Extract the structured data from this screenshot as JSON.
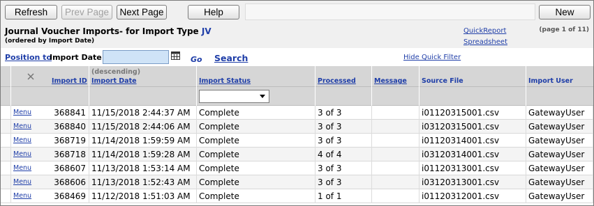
{
  "toolbar": {
    "refresh_label": "Refresh",
    "prev_page_label": "Prev Page",
    "next_page_label": "Next Page",
    "help_label": "Help",
    "new_label": "New"
  },
  "title": {
    "main_prefix": "Journal Voucher Imports- for Import Type ",
    "import_type": "JV",
    "subtitle": "(ordered by Import Date)",
    "quick_report": "QuickReport",
    "spreadsheet": "Spreadsheet",
    "page_info": "(page 1 of 11)"
  },
  "position": {
    "link_label": "Position to",
    "field_label": "Import Date",
    "input_value": "",
    "go_label": "Go",
    "search_label": "Search",
    "hide_filter_label": "Hide Quick Filter"
  },
  "grid": {
    "columns": {
      "import_id": "Import ID",
      "import_date_sort": "(descending)",
      "import_date": "Import Date",
      "import_status": "Import Status",
      "processed": "Processed",
      "message": "Message",
      "source_file": "Source File",
      "import_user": "Import User"
    },
    "filter": {
      "status_selected": ""
    },
    "rows": [
      {
        "menu": "Menu",
        "id": "368841",
        "date": "11/15/2018 2:44:37 AM",
        "status": "Complete",
        "processed": "3 of 3",
        "message": "",
        "file": "i01120315001.csv",
        "user": "GatewayUser"
      },
      {
        "menu": "Menu",
        "id": "368840",
        "date": "11/15/2018 2:44:06 AM",
        "status": "Complete",
        "processed": "3 of 3",
        "message": "",
        "file": "i03120315001.csv",
        "user": "GatewayUser"
      },
      {
        "menu": "Menu",
        "id": "368719",
        "date": "11/14/2018 1:59:59 AM",
        "status": "Complete",
        "processed": "3 of 3",
        "message": "",
        "file": "i01120314001.csv",
        "user": "GatewayUser"
      },
      {
        "menu": "Menu",
        "id": "368718",
        "date": "11/14/2018 1:59:28 AM",
        "status": "Complete",
        "processed": "4 of 4",
        "message": "",
        "file": "i03120314001.csv",
        "user": "GatewayUser"
      },
      {
        "menu": "Menu",
        "id": "368607",
        "date": "11/13/2018 1:53:14 AM",
        "status": "Complete",
        "processed": "3 of 3",
        "message": "",
        "file": "i01120313001.csv",
        "user": "GatewayUser"
      },
      {
        "menu": "Menu",
        "id": "368606",
        "date": "11/13/2018 1:52:43 AM",
        "status": "Complete",
        "processed": "3 of 3",
        "message": "",
        "file": "i03120313001.csv",
        "user": "GatewayUser"
      },
      {
        "menu": "Menu",
        "id": "368469",
        "date": "11/12/2018 1:51:03 AM",
        "status": "Complete",
        "processed": "1 of 1",
        "message": "",
        "file": "i01120312001.csv",
        "user": "GatewayUser"
      }
    ]
  },
  "colors": {
    "link": "#1f3ea8",
    "header_bg": "#d6d6d6",
    "input_bg": "#cfe3f7"
  },
  "icons": {
    "calendar": "calendar-icon",
    "close": "close-icon",
    "dropdown": "chevron-down-icon"
  }
}
